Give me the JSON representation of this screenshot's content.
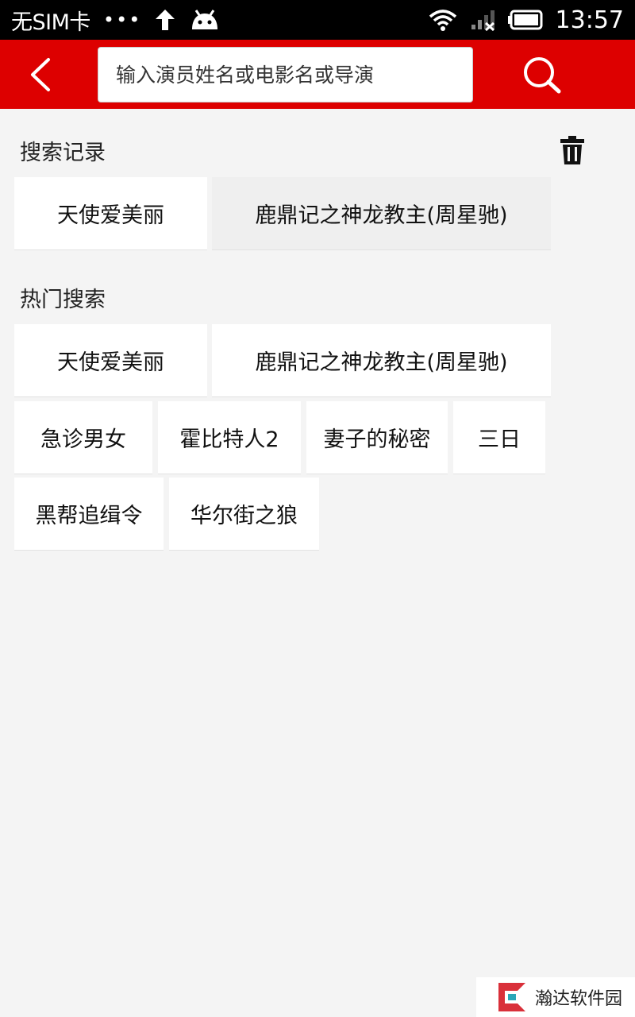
{
  "status_bar": {
    "carrier": "无SIM卡",
    "dots": "•••",
    "time": "13:57"
  },
  "header": {
    "search_placeholder": "输入演员姓名或电影名或导演"
  },
  "history": {
    "title": "搜索记录",
    "items": [
      "天使爱美丽",
      "鹿鼎记之神龙教主(周星驰)"
    ]
  },
  "hot": {
    "title": "热门搜索",
    "items": [
      "天使爱美丽",
      "鹿鼎记之神龙教主(周星驰)",
      "急诊男女",
      "霍比特人2",
      "妻子的秘密",
      "三日",
      "黑帮追缉令",
      "华尔街之狼"
    ]
  },
  "watermark": {
    "text": "瀚达软件园"
  },
  "colors": {
    "header_red": "#dd0000",
    "background": "#f4f4f4"
  },
  "icons": {
    "back": "chevron-left-icon",
    "search": "magnifier-icon",
    "trash": "trash-icon"
  }
}
